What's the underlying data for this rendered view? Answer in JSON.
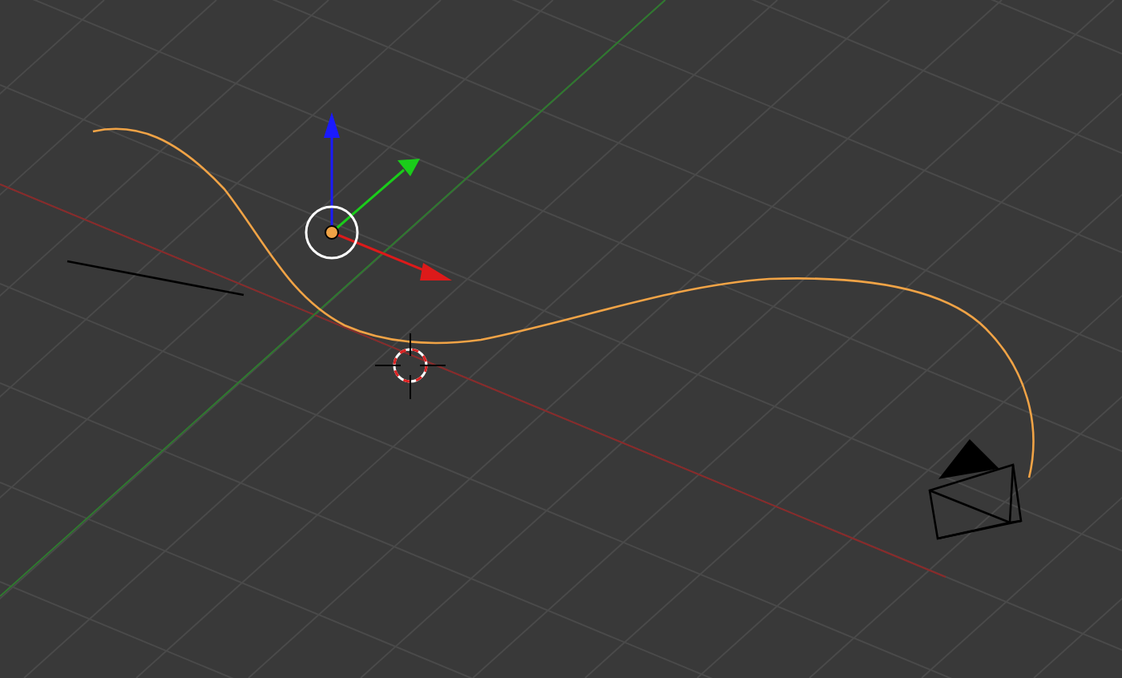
{
  "viewport": {
    "objects": [
      {
        "kind": "curve",
        "selected": true
      },
      {
        "kind": "camera",
        "selected": false
      },
      {
        "kind": "edge",
        "selected": false
      }
    ]
  }
}
